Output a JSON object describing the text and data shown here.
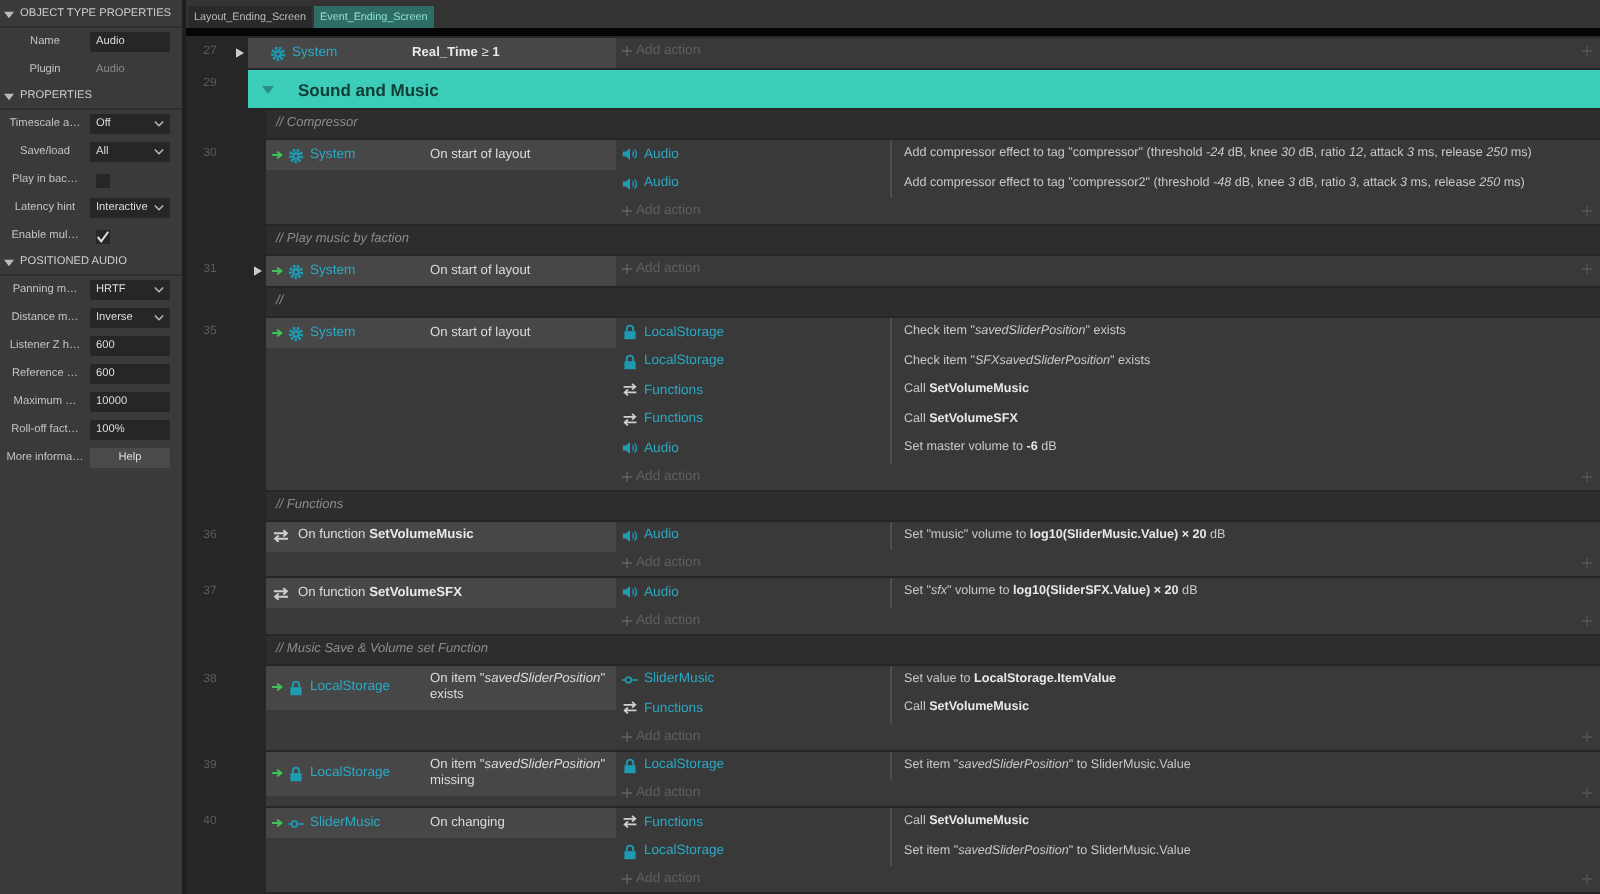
{
  "object_properties": {
    "sections": [
      {
        "title": "OBJECT TYPE PROPERTIES",
        "expanded": true,
        "rows": [
          {
            "label": "Name",
            "kind": "input",
            "value": "Audio"
          },
          {
            "label": "Plugin",
            "kind": "static",
            "value": "Audio"
          }
        ]
      },
      {
        "title": "PROPERTIES",
        "expanded": true,
        "rows": [
          {
            "label": "Timescale a…",
            "kind": "select",
            "value": "Off"
          },
          {
            "label": "Save/load",
            "kind": "select",
            "value": "All"
          },
          {
            "label": "Play in bac…",
            "kind": "checkbox",
            "checked": false
          },
          {
            "label": "Latency hint",
            "kind": "select",
            "value": "Interactive"
          },
          {
            "label": "Enable mul…",
            "kind": "checkbox",
            "checked": true
          }
        ]
      },
      {
        "title": "POSITIONED AUDIO",
        "expanded": true,
        "rows": [
          {
            "label": "Panning m…",
            "kind": "select",
            "value": "HRTF"
          },
          {
            "label": "Distance m…",
            "kind": "select",
            "value": "Inverse"
          },
          {
            "label": "Listener Z h…",
            "kind": "input",
            "value": "600"
          },
          {
            "label": "Reference …",
            "kind": "input",
            "value": "600"
          },
          {
            "label": "Maximum …",
            "kind": "input",
            "value": "10000"
          },
          {
            "label": "Roll-off fact…",
            "kind": "input",
            "value": "100%"
          },
          {
            "label": "More informa…",
            "kind": "button",
            "value": "Help"
          }
        ]
      }
    ]
  },
  "tabs": [
    {
      "label": "Layout_Ending_Screen",
      "selected": false
    },
    {
      "label": "Event_Ending_Screen",
      "selected": true
    }
  ],
  "events": [
    {
      "kind": "event",
      "number": "27",
      "has_subevents": true,
      "conditions": [
        {
          "kind": "system",
          "trigger": false,
          "object": "System",
          "text": "**Real_Time** ≥ **1**"
        }
      ],
      "add_action": "Add action"
    },
    {
      "kind": "group",
      "number": "29",
      "title": "Sound and Music",
      "expanded": true,
      "children": [
        {
          "kind": "comment",
          "text": "// Compressor"
        },
        {
          "kind": "event",
          "number": "30",
          "has_subevents": false,
          "conditions": [
            {
              "kind": "system",
              "trigger": true,
              "object": "System",
              "text": "On start of layout"
            }
          ],
          "actions": [
            {
              "kind": "audio",
              "object": "Audio",
              "text": "Add compressor effect to tag \"compressor\" (threshold *-24* dB, knee *30* dB, ratio *12*, attack *3* ms, release *250* ms)"
            },
            {
              "kind": "audio",
              "object": "Audio",
              "text": "Add compressor effect to tag \"compressor2\" (threshold *-48* dB, knee *3* dB, ratio *3*, attack *3* ms, release *250* ms)"
            }
          ],
          "add_action": "Add action"
        },
        {
          "kind": "comment",
          "text": "// Play music by faction"
        },
        {
          "kind": "event",
          "number": "31",
          "has_subevents": true,
          "conditions": [
            {
              "kind": "system",
              "trigger": true,
              "object": "System",
              "text": "On start of layout"
            }
          ],
          "add_action": "Add action"
        },
        {
          "kind": "comment",
          "text": "//"
        },
        {
          "kind": "event",
          "number": "35",
          "has_subevents": false,
          "conditions": [
            {
              "kind": "system",
              "trigger": true,
              "object": "System",
              "text": "On start of layout"
            }
          ],
          "actions": [
            {
              "kind": "storage",
              "object": "LocalStorage",
              "text": "Check item \"*savedSliderPosition*\" exists"
            },
            {
              "kind": "storage",
              "object": "LocalStorage",
              "text": "Check item \"*SFXsavedSliderPosition*\" exists"
            },
            {
              "kind": "functions",
              "object": "Functions",
              "text": "Call **SetVolumeMusic**"
            },
            {
              "kind": "functions",
              "object": "Functions",
              "text": "Call **SetVolumeSFX**"
            },
            {
              "kind": "audio",
              "object": "Audio",
              "text": "Set master volume to **-6** dB"
            }
          ],
          "add_action": "Add action"
        },
        {
          "kind": "comment",
          "text": "// Functions"
        },
        {
          "kind": "event",
          "number": "36",
          "has_subevents": false,
          "conditions": [
            {
              "kind": "function",
              "text": "On function **SetVolumeMusic**"
            }
          ],
          "actions": [
            {
              "kind": "audio",
              "object": "Audio",
              "text": "Set \"music\" volume to **log10(SliderMusic.Value) × 20** dB"
            }
          ],
          "add_action": "Add action"
        },
        {
          "kind": "event",
          "number": "37",
          "has_subevents": false,
          "conditions": [
            {
              "kind": "function",
              "text": "On function **SetVolumeSFX**"
            }
          ],
          "actions": [
            {
              "kind": "audio",
              "object": "Audio",
              "text": "Set \"*sfx*\" volume to **log10(SliderSFX.Value) × 20** dB"
            }
          ],
          "add_action": "Add action"
        },
        {
          "kind": "comment",
          "text": "// Music Save & Volume set Function"
        },
        {
          "kind": "event",
          "number": "38",
          "has_subevents": false,
          "conditions": [
            {
              "kind": "storage",
              "trigger": true,
              "object": "LocalStorage",
              "text": "On item \"*savedSliderPosition*\" exists"
            }
          ],
          "actions": [
            {
              "kind": "slider",
              "object": "SliderMusic",
              "text": "Set value to **LocalStorage.ItemValue**"
            },
            {
              "kind": "functions",
              "object": "Functions",
              "text": "Call **SetVolumeMusic**"
            }
          ],
          "add_action": "Add action"
        },
        {
          "kind": "event",
          "number": "39",
          "has_subevents": false,
          "conditions": [
            {
              "kind": "storage",
              "trigger": true,
              "object": "LocalStorage",
              "text": "On item \"*savedSliderPosition*\" missing"
            }
          ],
          "actions": [
            {
              "kind": "storage",
              "object": "LocalStorage",
              "text": "Set item \"*savedSliderPosition*\" to SliderMusic.Value"
            }
          ],
          "add_action": "Add action"
        },
        {
          "kind": "event",
          "number": "40",
          "has_subevents": false,
          "conditions": [
            {
              "kind": "slider",
              "trigger": true,
              "object": "SliderMusic",
              "text": "On changing"
            }
          ],
          "actions": [
            {
              "kind": "functions",
              "object": "Functions",
              "text": "Call **SetVolumeMusic**"
            },
            {
              "kind": "storage",
              "object": "LocalStorage",
              "text": "Set item \"*savedSliderPosition*\" to SliderMusic.Value"
            }
          ],
          "add_action": "Add action"
        }
      ]
    }
  ]
}
